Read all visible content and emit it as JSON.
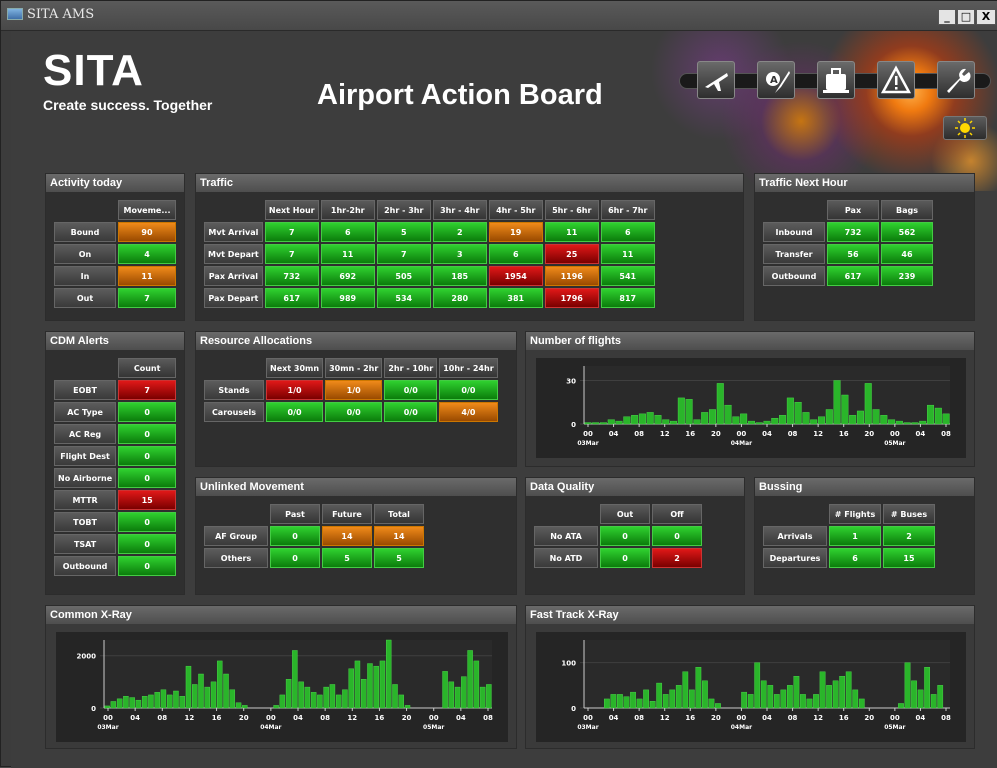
{
  "window": {
    "title": "SITA AMS",
    "min": "_",
    "max": "□",
    "close": "X"
  },
  "header": {
    "logo": "SITA",
    "tagline": "Create success. Together",
    "title": "Airport Action Board"
  },
  "toolbar": {
    "icons": [
      "departure-plane-icon",
      "airline-code-icon",
      "baggage-icon",
      "warning-icon",
      "wrench-icon"
    ]
  },
  "colors": {
    "green": "#19a519",
    "orange": "#d26f0c",
    "red": "#c01010",
    "panel": "#2f2f2f"
  },
  "activity": {
    "title": "Activity today",
    "header": "Moveme...",
    "rows": [
      {
        "label": "Bound",
        "value": "90",
        "status": "o"
      },
      {
        "label": "On",
        "value": "4",
        "status": "g"
      },
      {
        "label": "In",
        "value": "11",
        "status": "o"
      },
      {
        "label": "Out",
        "value": "7",
        "status": "g"
      }
    ]
  },
  "traffic": {
    "title": "Traffic",
    "headers": [
      "Next Hour",
      "1hr-2hr",
      "2hr - 3hr",
      "3hr - 4hr",
      "4hr - 5hr",
      "5hr - 6hr",
      "6hr - 7hr"
    ],
    "rows": [
      {
        "label": "Mvt Arrival",
        "cells": [
          {
            "v": "7",
            "s": "g"
          },
          {
            "v": "6",
            "s": "g"
          },
          {
            "v": "5",
            "s": "g"
          },
          {
            "v": "2",
            "s": "g"
          },
          {
            "v": "19",
            "s": "o"
          },
          {
            "v": "11",
            "s": "g"
          },
          {
            "v": "6",
            "s": "g"
          }
        ]
      },
      {
        "label": "Mvt Depart",
        "cells": [
          {
            "v": "7",
            "s": "g"
          },
          {
            "v": "11",
            "s": "g"
          },
          {
            "v": "7",
            "s": "g"
          },
          {
            "v": "3",
            "s": "g"
          },
          {
            "v": "6",
            "s": "g"
          },
          {
            "v": "25",
            "s": "r"
          },
          {
            "v": "11",
            "s": "g"
          }
        ]
      },
      {
        "label": "Pax Arrival",
        "cells": [
          {
            "v": "732",
            "s": "g"
          },
          {
            "v": "692",
            "s": "g"
          },
          {
            "v": "505",
            "s": "g"
          },
          {
            "v": "185",
            "s": "g"
          },
          {
            "v": "1954",
            "s": "r"
          },
          {
            "v": "1196",
            "s": "o"
          },
          {
            "v": "541",
            "s": "g"
          }
        ]
      },
      {
        "label": "Pax Depart",
        "cells": [
          {
            "v": "617",
            "s": "g"
          },
          {
            "v": "989",
            "s": "g"
          },
          {
            "v": "534",
            "s": "g"
          },
          {
            "v": "280",
            "s": "g"
          },
          {
            "v": "381",
            "s": "g"
          },
          {
            "v": "1796",
            "s": "r"
          },
          {
            "v": "817",
            "s": "g"
          }
        ]
      }
    ]
  },
  "traffic_next": {
    "title": "Traffic Next Hour",
    "headers": [
      "Pax",
      "Bags"
    ],
    "rows": [
      {
        "label": "Inbound",
        "cells": [
          {
            "v": "732",
            "s": "g"
          },
          {
            "v": "562",
            "s": "g"
          }
        ]
      },
      {
        "label": "Transfer",
        "cells": [
          {
            "v": "56",
            "s": "g"
          },
          {
            "v": "46",
            "s": "g"
          }
        ]
      },
      {
        "label": "Outbound",
        "cells": [
          {
            "v": "617",
            "s": "g"
          },
          {
            "v": "239",
            "s": "g"
          }
        ]
      }
    ]
  },
  "cdm": {
    "title": "CDM Alerts",
    "header": "Count",
    "rows": [
      {
        "label": "EOBT",
        "value": "7",
        "status": "r"
      },
      {
        "label": "AC Type",
        "value": "0",
        "status": "g"
      },
      {
        "label": "AC Reg",
        "value": "0",
        "status": "g"
      },
      {
        "label": "Flight Dest",
        "value": "0",
        "status": "g"
      },
      {
        "label": "No Airborne",
        "value": "0",
        "status": "g"
      },
      {
        "label": "MTTR",
        "value": "15",
        "status": "r"
      },
      {
        "label": "TOBT",
        "value": "0",
        "status": "g"
      },
      {
        "label": "TSAT",
        "value": "0",
        "status": "g"
      },
      {
        "label": "Outbound",
        "value": "0",
        "status": "g"
      }
    ]
  },
  "resources": {
    "title": "Resource Allocations",
    "headers": [
      "Next 30mn",
      "30mn - 2hr",
      "2hr - 10hr",
      "10hr - 24hr"
    ],
    "rows": [
      {
        "label": "Stands",
        "cells": [
          {
            "v": "1/0",
            "s": "r"
          },
          {
            "v": "1/0",
            "s": "o"
          },
          {
            "v": "0/0",
            "s": "g"
          },
          {
            "v": "0/0",
            "s": "g"
          }
        ]
      },
      {
        "label": "Carousels",
        "cells": [
          {
            "v": "0/0",
            "s": "g"
          },
          {
            "v": "0/0",
            "s": "g"
          },
          {
            "v": "0/0",
            "s": "g"
          },
          {
            "v": "4/0",
            "s": "o"
          }
        ]
      }
    ]
  },
  "unlinked": {
    "title": "Unlinked Movement",
    "headers": [
      "Past",
      "Future",
      "Total"
    ],
    "rows": [
      {
        "label": "AF Group",
        "cells": [
          {
            "v": "0",
            "s": "g"
          },
          {
            "v": "14",
            "s": "o"
          },
          {
            "v": "14",
            "s": "o"
          }
        ]
      },
      {
        "label": "Others",
        "cells": [
          {
            "v": "0",
            "s": "g"
          },
          {
            "v": "5",
            "s": "g"
          },
          {
            "v": "5",
            "s": "g"
          }
        ]
      }
    ]
  },
  "quality": {
    "title": "Data Quality",
    "headers": [
      "Out",
      "Off"
    ],
    "rows": [
      {
        "label": "No ATA",
        "cells": [
          {
            "v": "0",
            "s": "g"
          },
          {
            "v": "0",
            "s": "g"
          }
        ]
      },
      {
        "label": "No ATD",
        "cells": [
          {
            "v": "0",
            "s": "g"
          },
          {
            "v": "2",
            "s": "r"
          }
        ]
      }
    ]
  },
  "bussing": {
    "title": "Bussing",
    "headers": [
      "# Flights",
      "# Buses"
    ],
    "rows": [
      {
        "label": "Arrivals",
        "cells": [
          {
            "v": "1",
            "s": "g"
          },
          {
            "v": "2",
            "s": "g"
          }
        ]
      },
      {
        "label": "Departures",
        "cells": [
          {
            "v": "6",
            "s": "g"
          },
          {
            "v": "15",
            "s": "g"
          }
        ]
      }
    ]
  },
  "chart_titles": {
    "flights": "Number of flights",
    "xray": "Common X-Ray",
    "fast": "Fast Track X-Ray"
  },
  "chart_data": [
    {
      "type": "bar",
      "name": "flights",
      "ylim": [
        0,
        40
      ],
      "yticks": [
        "30",
        "0"
      ],
      "ytickvals": [
        30,
        0
      ],
      "xticks": [
        "00",
        "04",
        "08",
        "12",
        "16",
        "20",
        "00",
        "04",
        "08",
        "12",
        "16",
        "20",
        "00",
        "04",
        "08"
      ],
      "dates": [
        "03Mar",
        "04Mar",
        "05Mar"
      ],
      "values": [
        1,
        1,
        1,
        3,
        2,
        5,
        6,
        7,
        8,
        6,
        3,
        2,
        18,
        17,
        3,
        8,
        10,
        28,
        13,
        5,
        7,
        2,
        1,
        2,
        4,
        6,
        18,
        15,
        8,
        3,
        5,
        10,
        30,
        20,
        6,
        9,
        28,
        10,
        6,
        3,
        2,
        1,
        1,
        2,
        13,
        11,
        7
      ]
    },
    {
      "type": "bar",
      "name": "xray",
      "ylim": [
        0,
        2600
      ],
      "yticks": [
        "2000",
        "0"
      ],
      "ytickvals": [
        2000,
        0
      ],
      "xticks": [
        "00",
        "04",
        "08",
        "12",
        "16",
        "20",
        "00",
        "04",
        "08",
        "12",
        "16",
        "20",
        "00",
        "04",
        "08"
      ],
      "dates": [
        "03Mar",
        "04Mar",
        "05Mar"
      ],
      "values": [
        80,
        250,
        350,
        450,
        400,
        300,
        450,
        500,
        600,
        700,
        500,
        650,
        450,
        1600,
        900,
        1300,
        800,
        1000,
        1800,
        1300,
        700,
        200,
        100,
        0,
        0,
        0,
        0,
        100,
        500,
        1100,
        2200,
        1000,
        800,
        600,
        500,
        800,
        900,
        500,
        700,
        1500,
        1800,
        1100,
        1700,
        1600,
        1800,
        2600,
        900,
        500,
        100,
        0,
        0,
        0,
        0,
        0,
        1400,
        1000,
        800,
        1200,
        2200,
        1800,
        800,
        900
      ]
    },
    {
      "type": "bar",
      "name": "fast",
      "ylim": [
        0,
        150
      ],
      "yticks": [
        "100",
        "0"
      ],
      "ytickvals": [
        100,
        0
      ],
      "xticks": [
        "00",
        "04",
        "08",
        "12",
        "16",
        "20",
        "00",
        "04",
        "08",
        "12",
        "16",
        "20",
        "00",
        "04",
        "08"
      ],
      "dates": [
        "03Mar",
        "04Mar",
        "05Mar"
      ],
      "values": [
        0,
        0,
        0,
        20,
        30,
        30,
        25,
        35,
        20,
        40,
        15,
        55,
        30,
        40,
        50,
        80,
        40,
        90,
        60,
        20,
        10,
        0,
        0,
        0,
        35,
        30,
        100,
        60,
        50,
        30,
        40,
        50,
        70,
        30,
        20,
        30,
        80,
        50,
        60,
        70,
        80,
        40,
        20,
        0,
        0,
        0,
        0,
        0,
        10,
        100,
        60,
        40,
        90,
        30,
        50,
        0
      ]
    }
  ]
}
